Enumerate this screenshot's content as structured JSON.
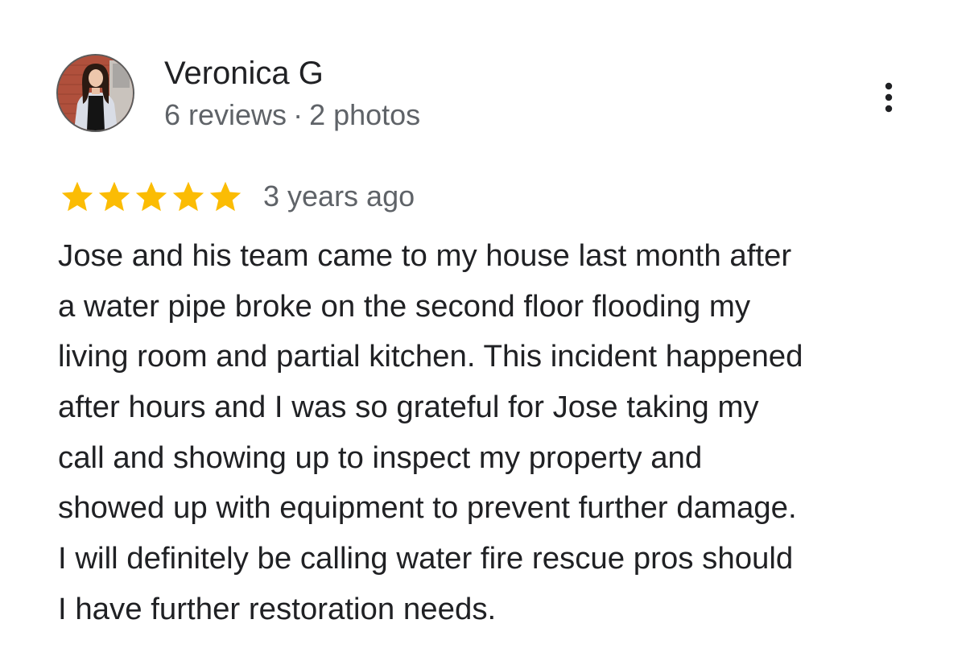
{
  "reviewer": {
    "name": "Veronica G",
    "reviews_count": "6 reviews",
    "separator": "·",
    "photos_count": "2 photos"
  },
  "review": {
    "rating": 5,
    "max_rating": 5,
    "date": "3 years ago",
    "lines": [
      "Jose and his team came to my house last month after",
      "a water pipe broke on the second floor flooding my",
      "living room and partial kitchen. This incident happened",
      "after hours and I was so grateful for Jose taking my",
      "call and showing up to inspect my property and",
      "showed up with equipment to prevent further damage.",
      "I will definitely be calling water fire rescue pros should",
      "I have further restoration needs."
    ]
  },
  "icons": {
    "more": "more-vertical-icon",
    "star": "star-icon"
  },
  "colors": {
    "star": "#FBBC04",
    "name": "#202124",
    "meta": "#5F6368",
    "text": "#202124"
  }
}
